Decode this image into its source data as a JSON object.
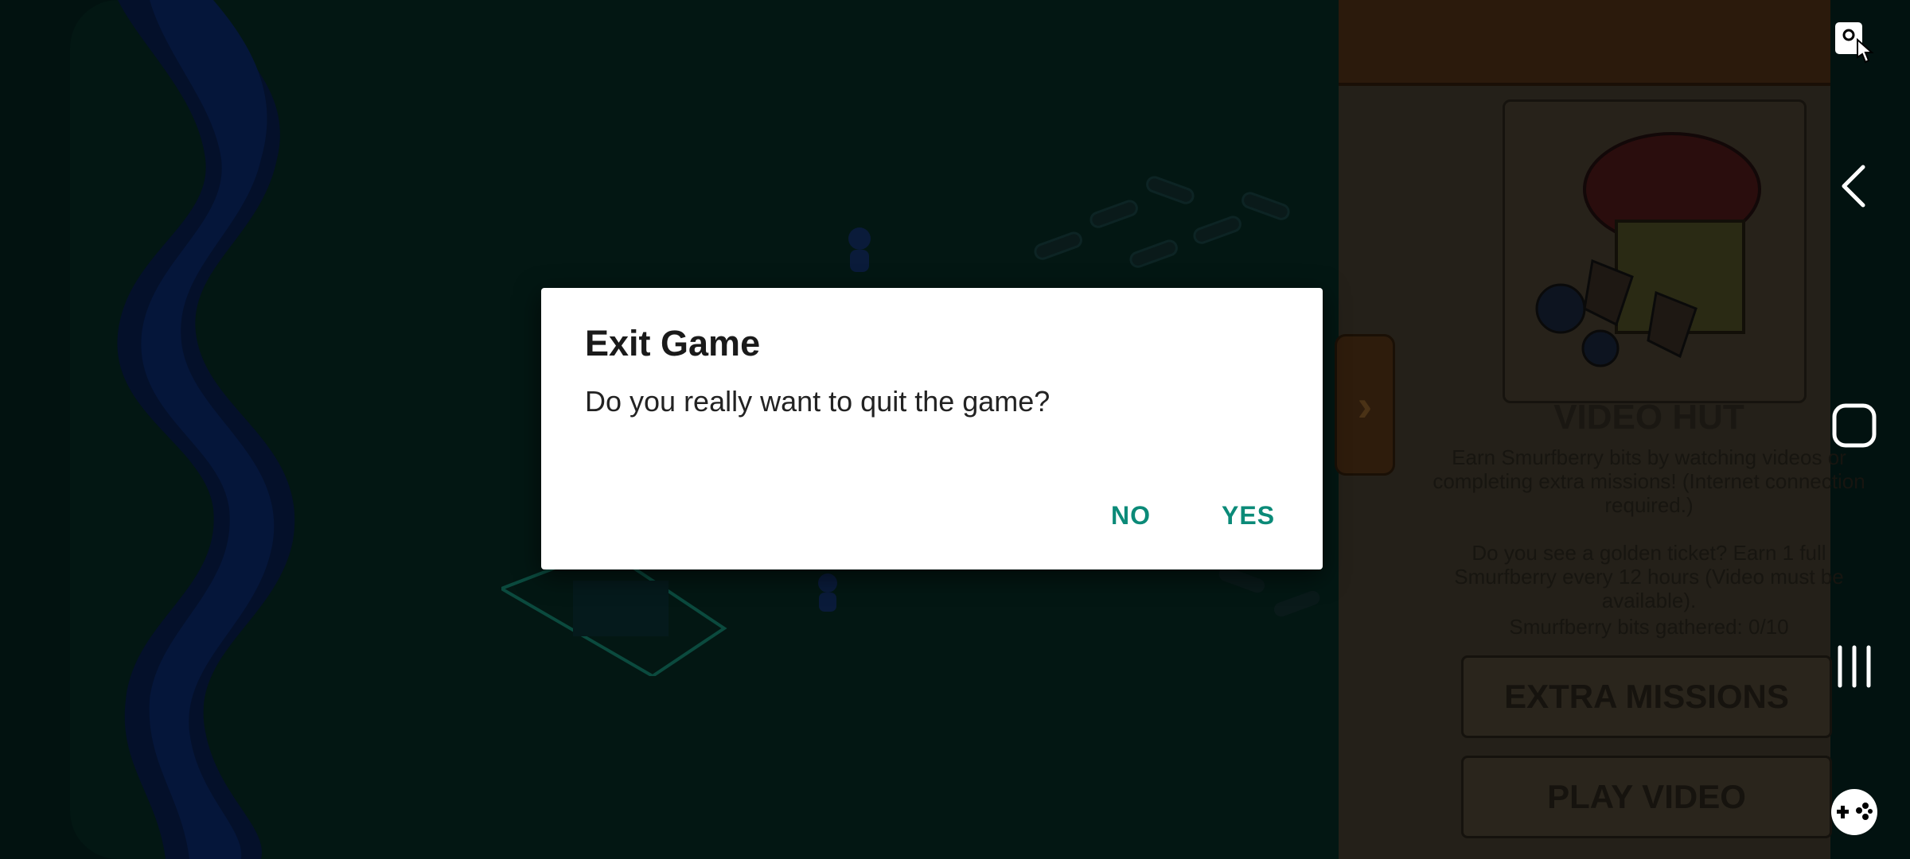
{
  "dialog": {
    "title": "Exit Game",
    "message": "Do you really want to quit the game?",
    "no_label": "NO",
    "yes_label": "YES",
    "accent_color": "#0b8a78"
  },
  "panel": {
    "title": "VIDEO HUT",
    "description": "Earn Smurfberry bits by watching videos or completing extra missions! (Internet connection required.)",
    "ticket_text": "Do you see a golden ticket? Earn 1 full Smurfberry every 12 hours (Video must be available).",
    "bits_gathered": "Smurfberry bits gathered: 0/10",
    "extra_missions_label": "EXTRA MISSIONS",
    "play_video_label": "PLAY VIDEO"
  },
  "navbar": {
    "icons": [
      "screenshot-touch-icon",
      "back-icon",
      "home-icon",
      "recents-icon",
      "gamepad-icon"
    ]
  }
}
